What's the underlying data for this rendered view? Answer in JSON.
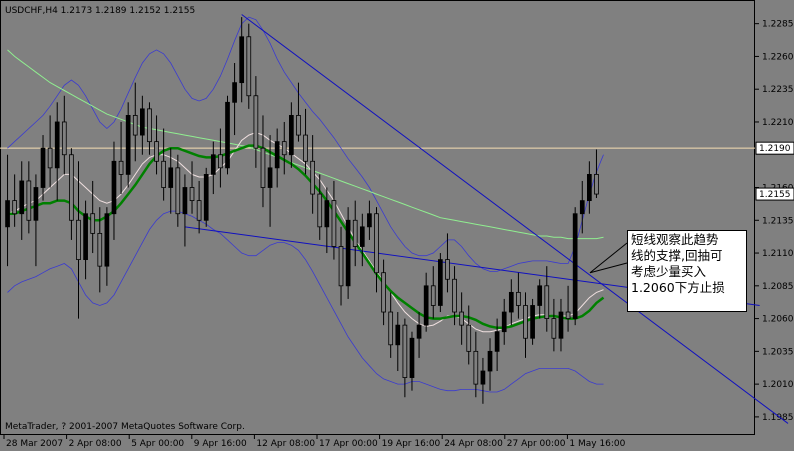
{
  "chart_data": {
    "type": "candlestick",
    "symbol_header": "USDCHF,H4  1.2173 1.2189 1.2152 1.2155",
    "copyright": "MetaTrader, ? 2001-2007 MetaQuotes Software Corp.",
    "ylim": [
      1.1975,
      1.23
    ],
    "y_ticks": [
      "1.2285",
      "1.2260",
      "1.2235",
      "1.2210",
      "1.2160",
      "1.2135",
      "1.2110",
      "1.2085",
      "1.2060",
      "1.2035",
      "1.2010",
      "1.1985"
    ],
    "x_ticks": [
      "28 Mar 2007",
      "2 Apr 08:00",
      "5 Apr 00:00",
      "9 Apr 16:00",
      "12 Apr 08:00",
      "17 Apr 00:00",
      "19 Apr 16:00",
      "24 Apr 08:00",
      "27 Apr 00:00",
      "1 May 16:00"
    ],
    "price_line": {
      "value": 1.219,
      "label": "1.2190",
      "color": "#f5deb3"
    },
    "bid_label": "1.2155",
    "annotation": [
      "短线观察此趋势",
      "线的支撑,回抽可",
      "考虑少量买入",
      "1.2060下方止损"
    ],
    "colors": {
      "background": "#808080",
      "frame": "#000000",
      "bull": "#000000",
      "bear": "#000000",
      "trend": "#1010c0",
      "bands": "#3a3ad0",
      "ma_green": "#008000",
      "ma_slow": "#90ee90",
      "ma_fast": "#f0e0e0"
    },
    "candles": [
      [
        1.213,
        1.2185,
        1.21,
        1.215
      ],
      [
        1.215,
        1.217,
        1.213,
        1.214
      ],
      [
        1.214,
        1.218,
        1.212,
        1.2165
      ],
      [
        1.2165,
        1.218,
        1.2125,
        1.2135
      ],
      [
        1.2135,
        1.217,
        1.21,
        1.216
      ],
      [
        1.216,
        1.22,
        1.215,
        1.219
      ],
      [
        1.219,
        1.2215,
        1.216,
        1.2175
      ],
      [
        1.2175,
        1.2225,
        1.215,
        1.221
      ],
      [
        1.221,
        1.223,
        1.217,
        1.2185
      ],
      [
        1.2185,
        1.219,
        1.212,
        1.2135
      ],
      [
        1.2135,
        1.218,
        1.206,
        1.2105
      ],
      [
        1.2105,
        1.215,
        1.209,
        1.214
      ],
      [
        1.214,
        1.2165,
        1.211,
        1.2125
      ],
      [
        1.2125,
        1.2145,
        1.208,
        1.21
      ],
      [
        1.21,
        1.2145,
        1.2085,
        1.214
      ],
      [
        1.214,
        1.2195,
        1.212,
        1.218
      ],
      [
        1.218,
        1.221,
        1.2155,
        1.217
      ],
      [
        1.217,
        1.2225,
        1.216,
        1.2215
      ],
      [
        1.2215,
        1.224,
        1.218,
        1.22
      ],
      [
        1.22,
        1.223,
        1.2185,
        1.222
      ],
      [
        1.222,
        1.2225,
        1.2185,
        1.2195
      ],
      [
        1.2195,
        1.2215,
        1.217,
        1.218
      ],
      [
        1.218,
        1.2205,
        1.215,
        1.216
      ],
      [
        1.216,
        1.219,
        1.214,
        1.2175
      ],
      [
        1.2175,
        1.2185,
        1.213,
        1.214
      ],
      [
        1.214,
        1.217,
        1.2115,
        1.216
      ],
      [
        1.216,
        1.218,
        1.214,
        1.215
      ],
      [
        1.215,
        1.2165,
        1.2125,
        1.2135
      ],
      [
        1.2135,
        1.2175,
        1.213,
        1.217
      ],
      [
        1.217,
        1.2195,
        1.2155,
        1.2185
      ],
      [
        1.2185,
        1.2205,
        1.216,
        1.2175
      ],
      [
        1.2175,
        1.223,
        1.217,
        1.2225
      ],
      [
        1.2225,
        1.2255,
        1.22,
        1.224
      ],
      [
        1.224,
        1.229,
        1.2225,
        1.2275
      ],
      [
        1.2275,
        1.2285,
        1.222,
        1.223
      ],
      [
        1.223,
        1.2245,
        1.2175,
        1.219
      ],
      [
        1.219,
        1.2215,
        1.2145,
        1.216
      ],
      [
        1.216,
        1.22,
        1.213,
        1.2175
      ],
      [
        1.2175,
        1.2205,
        1.216,
        1.2195
      ],
      [
        1.2195,
        1.221,
        1.217,
        1.2185
      ],
      [
        1.2185,
        1.2225,
        1.2175,
        1.2215
      ],
      [
        1.2215,
        1.224,
        1.2195,
        1.22
      ],
      [
        1.22,
        1.222,
        1.217,
        1.218
      ],
      [
        1.218,
        1.22,
        1.214,
        1.2155
      ],
      [
        1.2155,
        1.217,
        1.212,
        1.213
      ],
      [
        1.213,
        1.216,
        1.211,
        1.215
      ],
      [
        1.215,
        1.2165,
        1.2105,
        1.2115
      ],
      [
        1.2115,
        1.213,
        1.207,
        1.2085
      ],
      [
        1.2085,
        1.2145,
        1.2075,
        1.2135
      ],
      [
        1.2135,
        1.215,
        1.21,
        1.2115
      ],
      [
        1.2115,
        1.214,
        1.21,
        1.213
      ],
      [
        1.213,
        1.215,
        1.212,
        1.214
      ],
      [
        1.214,
        1.2145,
        1.208,
        1.2095
      ],
      [
        1.2095,
        1.2105,
        1.2055,
        1.2065
      ],
      [
        1.2065,
        1.208,
        1.203,
        1.204
      ],
      [
        1.204,
        1.2065,
        1.202,
        1.2055
      ],
      [
        1.2055,
        1.206,
        1.2,
        1.2015
      ],
      [
        1.2015,
        1.205,
        1.2005,
        1.2045
      ],
      [
        1.2045,
        1.2065,
        1.203,
        1.2055
      ],
      [
        1.2055,
        1.2095,
        1.205,
        1.2085
      ],
      [
        1.2085,
        1.21,
        1.206,
        1.207
      ],
      [
        1.207,
        1.211,
        1.2065,
        1.2105
      ],
      [
        1.2105,
        1.2125,
        1.208,
        1.209
      ],
      [
        1.209,
        1.21,
        1.2055,
        1.2065
      ],
      [
        1.2065,
        1.208,
        1.204,
        1.2055
      ],
      [
        1.2055,
        1.207,
        1.2025,
        1.2035
      ],
      [
        1.2035,
        1.205,
        1.2,
        1.201
      ],
      [
        1.201,
        1.203,
        1.1995,
        1.202
      ],
      [
        1.202,
        1.2045,
        1.2005,
        1.2035
      ],
      [
        1.2035,
        1.206,
        1.202,
        1.205
      ],
      [
        1.205,
        1.2075,
        1.204,
        1.2065
      ],
      [
        1.2065,
        1.209,
        1.2055,
        1.208
      ],
      [
        1.208,
        1.2095,
        1.206,
        1.207
      ],
      [
        1.207,
        1.208,
        1.203,
        1.2045
      ],
      [
        1.2045,
        1.2075,
        1.204,
        1.207
      ],
      [
        1.207,
        1.209,
        1.206,
        1.2085
      ],
      [
        1.2085,
        1.21,
        1.205,
        1.206
      ],
      [
        1.206,
        1.2075,
        1.2035,
        1.2045
      ],
      [
        1.2045,
        1.2075,
        1.2035,
        1.2065
      ],
      [
        1.2065,
        1.2085,
        1.205,
        1.206
      ],
      [
        1.206,
        1.2145,
        1.2055,
        1.214
      ],
      [
        1.214,
        1.2165,
        1.2125,
        1.215
      ],
      [
        1.215,
        1.218,
        1.214,
        1.217
      ],
      [
        1.217,
        1.2189,
        1.2152,
        1.2155
      ]
    ],
    "ma_fast": [
      1.214,
      1.2142,
      1.2145,
      1.2148,
      1.215,
      1.2155,
      1.216,
      1.2165,
      1.217,
      1.217,
      1.2165,
      1.216,
      1.2155,
      1.215,
      1.2148,
      1.215,
      1.2155,
      1.2162,
      1.217,
      1.2178,
      1.2183,
      1.2185,
      1.2185,
      1.2183,
      1.218,
      1.2175,
      1.217,
      1.2168,
      1.2168,
      1.217,
      1.2175,
      1.218,
      1.2188,
      1.2196,
      1.22,
      1.2202,
      1.22,
      1.2196,
      1.2193,
      1.219,
      1.2186,
      1.2182,
      1.2178,
      1.2172,
      1.2166,
      1.2158,
      1.215,
      1.214,
      1.213,
      1.212,
      1.2112,
      1.2104,
      1.2096,
      1.2088,
      1.208,
      1.2072,
      1.2065,
      1.206,
      1.2056,
      1.2054,
      1.2055,
      1.2058,
      1.2062,
      1.2062,
      1.206,
      1.2056,
      1.2052,
      1.205,
      1.205,
      1.2051,
      1.2053,
      1.2056,
      1.2058,
      1.206,
      1.2062,
      1.2063,
      1.2063,
      1.2062,
      1.2062,
      1.2062,
      1.2064,
      1.207,
      1.2076,
      1.208,
      1.2082
    ],
    "ma_green": [
      1.214,
      1.214,
      1.2142,
      1.2144,
      1.2146,
      1.2148,
      1.2148,
      1.215,
      1.215,
      1.2148,
      1.2142,
      1.2138,
      1.2135,
      1.2135,
      1.2138,
      1.2142,
      1.2148,
      1.2155,
      1.2162,
      1.217,
      1.2178,
      1.2184,
      1.2188,
      1.219,
      1.219,
      1.2188,
      1.2186,
      1.2184,
      1.2183,
      1.2183,
      1.2184,
      1.2186,
      1.2188,
      1.219,
      1.2192,
      1.2192,
      1.219,
      1.2187,
      1.2184,
      1.2181,
      1.2178,
      1.2174,
      1.2169,
      1.2163,
      1.2157,
      1.215,
      1.2142,
      1.2134,
      1.2126,
      1.2118,
      1.211,
      1.2102,
      1.2094,
      1.2087,
      1.2081,
      1.2076,
      1.2072,
      1.2068,
      1.2064,
      1.2061,
      1.206,
      1.206,
      1.2061,
      1.2062,
      1.2062,
      1.2061,
      1.2059,
      1.2056,
      1.2054,
      1.2053,
      1.2053,
      1.2054,
      1.2056,
      1.2058,
      1.206,
      1.2061,
      1.2062,
      1.2062,
      1.2061,
      1.206,
      1.206,
      1.2062,
      1.2066,
      1.2072,
      1.2076
    ],
    "ma_slow": [
      1.2265,
      1.226,
      1.2256,
      1.2252,
      1.2248,
      1.2244,
      1.224,
      1.2237,
      1.2234,
      1.2231,
      1.2228,
      1.2225,
      1.2222,
      1.2219,
      1.2216,
      1.2214,
      1.2212,
      1.221,
      1.2208,
      1.2206,
      1.2205,
      1.2204,
      1.2203,
      1.2202,
      1.2201,
      1.22,
      1.2199,
      1.2198,
      1.2197,
      1.2196,
      1.2195,
      1.2194,
      1.2193,
      1.2192,
      1.2191,
      1.2189,
      1.2187,
      1.2185,
      1.2183,
      1.2181,
      1.2179,
      1.2177,
      1.2175,
      1.2173,
      1.2171,
      1.2169,
      1.2167,
      1.2165,
      1.2163,
      1.2161,
      1.2159,
      1.2157,
      1.2155,
      1.2153,
      1.2151,
      1.2149,
      1.2147,
      1.2145,
      1.2143,
      1.2141,
      1.2139,
      1.2137,
      1.2136,
      1.2135,
      1.2134,
      1.2133,
      1.2132,
      1.2131,
      1.213,
      1.2129,
      1.2128,
      1.2127,
      1.2126,
      1.2125,
      1.2124,
      1.2123,
      1.2123,
      1.2122,
      1.2122,
      1.2121,
      1.2121,
      1.2121,
      1.2121,
      1.2121,
      1.2122
    ],
    "band_upper": [
      1.219,
      1.2195,
      1.22,
      1.2205,
      1.221,
      1.2215,
      1.2222,
      1.223,
      1.2238,
      1.2242,
      1.2238,
      1.223,
      1.222,
      1.221,
      1.2205,
      1.221,
      1.222,
      1.2232,
      1.2244,
      1.2255,
      1.2262,
      1.2265,
      1.2262,
      1.2255,
      1.2245,
      1.2235,
      1.2228,
      1.2226,
      1.2228,
      1.2235,
      1.2245,
      1.2258,
      1.2272,
      1.2285,
      1.229,
      1.2288,
      1.228,
      1.227,
      1.2258,
      1.2248,
      1.224,
      1.2232,
      1.2225,
      1.2218,
      1.2212,
      1.2205,
      1.2198,
      1.219,
      1.2182,
      1.2175,
      1.2168,
      1.216,
      1.215,
      1.214,
      1.213,
      1.2122,
      1.2115,
      1.211,
      1.2108,
      1.2108,
      1.211,
      1.2115,
      1.212,
      1.212,
      1.2115,
      1.2108,
      1.2102,
      1.2098,
      1.2096,
      1.2096,
      1.2098,
      1.21,
      1.2102,
      1.2103,
      1.2104,
      1.2104,
      1.2104,
      1.2103,
      1.2102,
      1.2102,
      1.2115,
      1.2135,
      1.2155,
      1.2172,
      1.2185
    ],
    "band_lower": [
      1.208,
      1.2085,
      1.2088,
      1.209,
      1.2092,
      1.2095,
      1.2098,
      1.21,
      1.2102,
      1.2098,
      1.2088,
      1.2078,
      1.2072,
      1.207,
      1.2072,
      1.2078,
      1.2088,
      1.2098,
      1.2108,
      1.2118,
      1.2128,
      1.2135,
      1.214,
      1.2142,
      1.2142,
      1.214,
      1.2138,
      1.2135,
      1.2132,
      1.2128,
      1.2125,
      1.212,
      1.2115,
      1.211,
      1.2108,
      1.2108,
      1.2112,
      1.2116,
      1.2118,
      1.2118,
      1.2116,
      1.2112,
      1.2105,
      1.2096,
      1.2086,
      1.2076,
      1.2066,
      1.2056,
      1.2046,
      1.2038,
      1.203,
      1.2024,
      1.2018,
      1.2014,
      1.2012,
      1.201,
      1.201,
      1.2012,
      1.2012,
      1.201,
      1.2008,
      1.2006,
      1.2005,
      1.2005,
      1.2006,
      1.2006,
      1.2006,
      1.2005,
      1.2004,
      1.2004,
      1.2006,
      1.201,
      1.2014,
      1.2018,
      1.202,
      1.2022,
      1.2022,
      1.2022,
      1.2022,
      1.2022,
      1.202,
      1.2016,
      1.2012,
      1.201,
      1.201
    ],
    "trendlines": [
      {
        "from": [
          33,
          1.2292
        ],
        "to": [
          110,
          1.198
        ],
        "color": "#1010c0"
      },
      {
        "from": [
          25,
          1.213
        ],
        "to": [
          106,
          1.207
        ],
        "color": "#1010c0"
      }
    ],
    "arrow": {
      "from_value": 1.211,
      "to_value": 1.2095
    }
  }
}
